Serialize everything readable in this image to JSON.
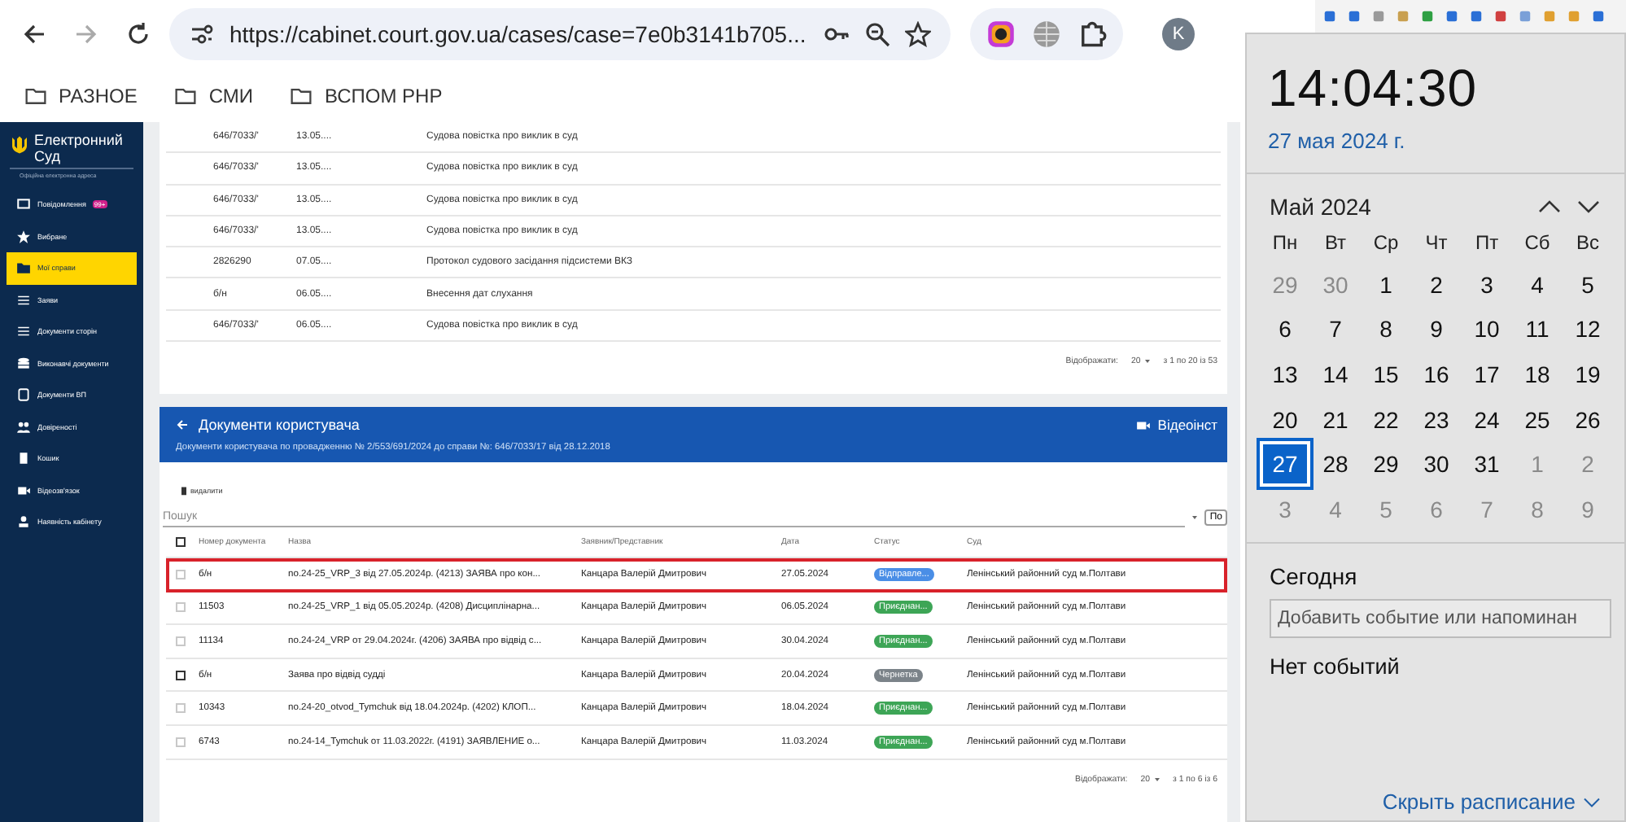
{
  "browser": {
    "url": "https://cabinet.court.gov.ua/cases/case=7e0b3141b705...",
    "profile": "K",
    "bookmarks": [
      "РАЗНОЕ",
      "СМИ",
      "ВСПОМ PHP"
    ]
  },
  "sidebar": {
    "logo_title": "Електронний Суд",
    "logo_subtitle": "Офіційна електронна адреса",
    "items": [
      {
        "label": "Повідомлення",
        "badge": "99+",
        "selected": false
      },
      {
        "label": "Вибране",
        "selected": false
      },
      {
        "label": "Мої справи",
        "selected": true
      },
      {
        "label": "Заяви",
        "selected": false
      },
      {
        "label": "Документи сторін",
        "selected": false
      },
      {
        "label": "Виконавчі документи",
        "selected": false
      },
      {
        "label": "Документи ВП",
        "selected": false
      },
      {
        "label": "Довіреності",
        "selected": false
      },
      {
        "label": "Кошик",
        "selected": false
      },
      {
        "label": "Відеозв'язок",
        "selected": false
      },
      {
        "label": "Наявність кабінету",
        "selected": false
      }
    ]
  },
  "case_documents": {
    "rows": [
      [
        "646/7033/'",
        "13.05....",
        "Судова повістка про виклик в суд"
      ],
      [
        "646/7033/'",
        "13.05....",
        "Судова повістка про виклик в суд"
      ],
      [
        "646/7033/'",
        "13.05....",
        "Судова повістка про виклик в суд"
      ],
      [
        "646/7033/'",
        "13.05....",
        "Судова повістка про виклик в суд"
      ],
      [
        "2826290",
        "07.05....",
        "Протокол судового засідання підсистеми ВКЗ"
      ],
      [
        "б/н",
        "06.05....",
        "Внесення дат слухання"
      ],
      [
        "646/7033/'",
        "06.05....",
        "Судова повістка про виклик в суд"
      ]
    ],
    "pager_label": "Відображати:",
    "page_size": "20",
    "range": "з 1 по 20 із 53"
  },
  "user_documents": {
    "title": "Документи користувача",
    "video_button": "Відеоінст",
    "subtitle": "Документи користувача по провадженню № 2/553/691/2024 до справи №: 646/7033/17 від 28.12.2018",
    "delete_button": "видалити",
    "search_placeholder": "Пошук",
    "side_button": "По",
    "select_all_checked": false,
    "columns": [
      "Номер документа",
      "Назва",
      "Заявник/Представник",
      "Дата",
      "Статус",
      "Суд"
    ],
    "rows": [
      {
        "number": "б/н",
        "name": "no.24-25_VRP_3 від 27.05.2024р. (4213) ЗАЯВА про кон...",
        "applicant": "Канцара Валерій Дмитрович",
        "date": "27.05.2024",
        "status": "Відправле...",
        "color": "#4a8ee6",
        "court": "Ленінський районний суд м.Полтави",
        "disabled": true,
        "outlined": true
      },
      {
        "number": "11503",
        "name": "no.24-25_VRP_1 від 05.05.2024р. (4208) Дисциплінарна...",
        "applicant": "Канцара Валерій Дмитрович",
        "date": "06.05.2024",
        "status": "Приєднан...",
        "color": "#3da556",
        "court": "Ленінський районний суд м.Полтави",
        "disabled": true,
        "outlined": false
      },
      {
        "number": "11134",
        "name": "no.24-24_VRP от 29.04.2024г. (4206) ЗАЯВА про відвід с...",
        "applicant": "Канцара Валерій Дмитрович",
        "date": "30.04.2024",
        "status": "Приєднан...",
        "color": "#3da556",
        "court": "Ленінський районний суд м.Полтави",
        "disabled": true,
        "outlined": false
      },
      {
        "number": "б/н",
        "name": "Заява про відвід судді",
        "applicant": "Канцара Валерій Дмитрович",
        "date": "20.04.2024",
        "status": "Чернетка",
        "color": "#7b8389",
        "court": "Ленінський районний суд м.Полтави",
        "disabled": false,
        "outlined": false
      },
      {
        "number": "10343",
        "name": "no.24-20_otvod_Tymchuk від 18.04.2024р. (4202) КЛОП...",
        "applicant": "Канцара Валерій Дмитрович",
        "date": "18.04.2024",
        "status": "Приєднан...",
        "color": "#3da556",
        "court": "Ленінський районний суд м.Полтави",
        "disabled": true,
        "outlined": false
      },
      {
        "number": "6743",
        "name": "no.24-14_Tymchuk от 11.03.2022г. (4191) ЗАЯВЛЕНИЕ о...",
        "applicant": "Канцара Валерій Дмитрович",
        "date": "11.03.2024",
        "status": "Приєднан...",
        "color": "#3da556",
        "court": "Ленінський районний суд м.Полтави",
        "disabled": true,
        "outlined": false
      }
    ],
    "pager_label": "Відображати:",
    "page_size": "20",
    "range": "з 1 по 6 із 6"
  },
  "clock": {
    "time": "14:04:30",
    "date": "27 мая 2024 г.",
    "month": "Май 2024",
    "weekdays": [
      "Пн",
      "Вт",
      "Ср",
      "Чт",
      "Пт",
      "Сб",
      "Вс"
    ],
    "days": [
      {
        "day": "29",
        "in_month": false,
        "selected": false
      },
      {
        "day": "30",
        "in_month": false,
        "selected": false
      },
      {
        "day": "1",
        "in_month": true,
        "selected": false
      },
      {
        "day": "2",
        "in_month": true,
        "selected": false
      },
      {
        "day": "3",
        "in_month": true,
        "selected": false
      },
      {
        "day": "4",
        "in_month": true,
        "selected": false
      },
      {
        "day": "5",
        "in_month": true,
        "selected": false
      },
      {
        "day": "6",
        "in_month": true,
        "selected": false
      },
      {
        "day": "7",
        "in_month": true,
        "selected": false
      },
      {
        "day": "8",
        "in_month": true,
        "selected": false
      },
      {
        "day": "9",
        "in_month": true,
        "selected": false
      },
      {
        "day": "10",
        "in_month": true,
        "selected": false
      },
      {
        "day": "11",
        "in_month": true,
        "selected": false
      },
      {
        "day": "12",
        "in_month": true,
        "selected": false
      },
      {
        "day": "13",
        "in_month": true,
        "selected": false
      },
      {
        "day": "14",
        "in_month": true,
        "selected": false
      },
      {
        "day": "15",
        "in_month": true,
        "selected": false
      },
      {
        "day": "16",
        "in_month": true,
        "selected": false
      },
      {
        "day": "17",
        "in_month": true,
        "selected": false
      },
      {
        "day": "18",
        "in_month": true,
        "selected": false
      },
      {
        "day": "19",
        "in_month": true,
        "selected": false
      },
      {
        "day": "20",
        "in_month": true,
        "selected": false
      },
      {
        "day": "21",
        "in_month": true,
        "selected": false
      },
      {
        "day": "22",
        "in_month": true,
        "selected": false
      },
      {
        "day": "23",
        "in_month": true,
        "selected": false
      },
      {
        "day": "24",
        "in_month": true,
        "selected": false
      },
      {
        "day": "25",
        "in_month": true,
        "selected": false
      },
      {
        "day": "26",
        "in_month": true,
        "selected": false
      },
      {
        "day": "27",
        "in_month": true,
        "selected": true
      },
      {
        "day": "28",
        "in_month": true,
        "selected": false
      },
      {
        "day": "29",
        "in_month": true,
        "selected": false
      },
      {
        "day": "30",
        "in_month": true,
        "selected": false
      },
      {
        "day": "31",
        "in_month": true,
        "selected": false
      },
      {
        "day": "1",
        "in_month": false,
        "selected": false
      },
      {
        "day": "2",
        "in_month": false,
        "selected": false
      },
      {
        "day": "3",
        "in_month": false,
        "selected": false
      },
      {
        "day": "4",
        "in_month": false,
        "selected": false
      },
      {
        "day": "5",
        "in_month": false,
        "selected": false
      },
      {
        "day": "6",
        "in_month": false,
        "selected": false
      },
      {
        "day": "7",
        "in_month": false,
        "selected": false
      },
      {
        "day": "8",
        "in_month": false,
        "selected": false
      },
      {
        "day": "9",
        "in_month": false,
        "selected": false
      }
    ],
    "today_label": "Сегодня",
    "event_placeholder": "Добавить событие или напоминан",
    "no_events": "Нет событий",
    "hide_link": "Скрыть расписание"
  }
}
